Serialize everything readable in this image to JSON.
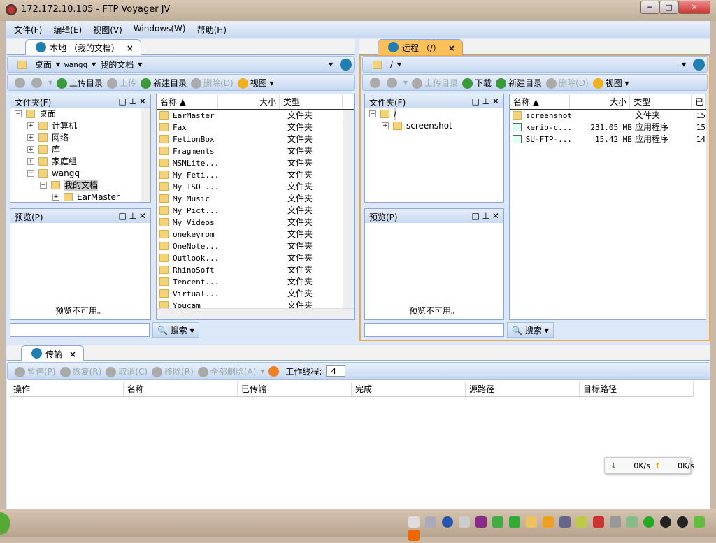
{
  "window": {
    "title": "172.172.10.105 - FTP Voyager JV",
    "min": "─",
    "max": "□",
    "close": "✕"
  },
  "menu": [
    "文件(F)",
    "编辑(E)",
    "视图(V)",
    "Windows(W)",
    "帮助(H)"
  ],
  "local": {
    "tab": "本地 （我的文档）",
    "close": "×",
    "path": [
      "桌面",
      "wangq",
      "我的文档"
    ],
    "toolbar": {
      "upload_dir": "上传目录",
      "upload": "上传",
      "new_dir": "新建目录",
      "delete": "删除(D)",
      "view": "视图"
    },
    "folder_title": "文件夹(F)",
    "tree": [
      {
        "label": "桌面",
        "exp": "−",
        "lvl": 0
      },
      {
        "label": "计算机",
        "exp": "+",
        "lvl": 1
      },
      {
        "label": "网络",
        "exp": "+",
        "lvl": 1
      },
      {
        "label": "库",
        "exp": "+",
        "lvl": 1
      },
      {
        "label": "家庭组",
        "exp": "+",
        "lvl": 1
      },
      {
        "label": "wangq",
        "exp": "−",
        "lvl": 1
      },
      {
        "label": "我的文档",
        "exp": "−",
        "lvl": 2
      },
      {
        "label": "EarMaster",
        "exp": "+",
        "lvl": 3
      }
    ],
    "preview_title": "预览(P)",
    "preview_msg": "预览不可用。",
    "columns": {
      "name": "名称 ▲",
      "size": "大小",
      "type": "类型"
    },
    "files": [
      [
        "EarMaster",
        "文件夹"
      ],
      [
        "Fax",
        "文件夹"
      ],
      [
        "FetionBox",
        "文件夹"
      ],
      [
        "Fragments",
        "文件夹"
      ],
      [
        "MSNLite...",
        "文件夹"
      ],
      [
        "My Feti...",
        "文件夹"
      ],
      [
        "My ISO ...",
        "文件夹"
      ],
      [
        "My Music",
        "文件夹"
      ],
      [
        "My Pict...",
        "文件夹"
      ],
      [
        "My Videos",
        "文件夹"
      ],
      [
        "onekeyrom",
        "文件夹"
      ],
      [
        "OneNote...",
        "文件夹"
      ],
      [
        "Outlook...",
        "文件夹"
      ],
      [
        "RhinoSoft",
        "文件夹"
      ],
      [
        "Tencent...",
        "文件夹"
      ],
      [
        "Virtual...",
        "文件夹"
      ],
      [
        "Youcam",
        "文件夹"
      ]
    ],
    "search": "搜索"
  },
  "remote": {
    "tab": "远程 （/）",
    "close": "×",
    "path": [
      "/"
    ],
    "toolbar": {
      "upload_dir": "上传目录",
      "download": "下载",
      "new_dir": "新建目录",
      "delete": "删除(D)",
      "view": "视图"
    },
    "folder_title": "文件夹(F)",
    "tree": [
      {
        "label": "/",
        "exp": "−",
        "lvl": 0
      },
      {
        "label": "screenshot",
        "exp": "+",
        "lvl": 1
      }
    ],
    "preview_title": "预览(P)",
    "preview_msg": "预览不可用。",
    "columns": {
      "name": "名称 ▲",
      "size": "大小",
      "type": "类型",
      "date": "已"
    },
    "files": [
      [
        "screenshot",
        "",
        "文件夹",
        "15"
      ],
      [
        "kerio-c...",
        "231.05 MB",
        "应用程序",
        "15"
      ],
      [
        "SU-FTP-...",
        "15.42 MB",
        "应用程序",
        "14"
      ]
    ],
    "search": "搜索"
  },
  "transfer": {
    "tab": "传输",
    "close": "×",
    "toolbar": {
      "pause": "暂停(P)",
      "resume": "恢复(R)",
      "cancel": "取消(C)",
      "remove": "移除(R)",
      "remove_all": "全部删除(A)",
      "threads_label": "工作线程:",
      "threads": "4"
    },
    "columns": [
      "操作",
      "名称",
      "已传输",
      "完成",
      "源路径",
      "目标路径"
    ],
    "down_speed": "0K/s",
    "up_speed": "0K/s"
  }
}
